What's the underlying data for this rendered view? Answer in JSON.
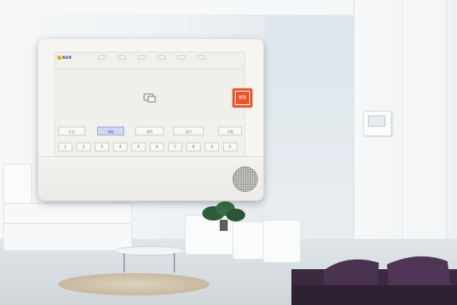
{
  "panel": {
    "brand": "AUX",
    "alarm_label": "安防",
    "function_buttons": [
      "开启",
      "布防",
      "撤防",
      "留守",
      "设置"
    ],
    "keypad": [
      "1",
      "2",
      "3",
      "4",
      "5",
      "6",
      "7",
      "8",
      "9",
      "0"
    ]
  },
  "colors": {
    "alarm_button": "#e8562f",
    "active_tab": "#cfd8f4",
    "brand_text": "#2b4f93"
  },
  "icons": {
    "alarm": "alarm-icon",
    "card_reader": "card-icon",
    "speaker": "speaker-grille-icon"
  }
}
